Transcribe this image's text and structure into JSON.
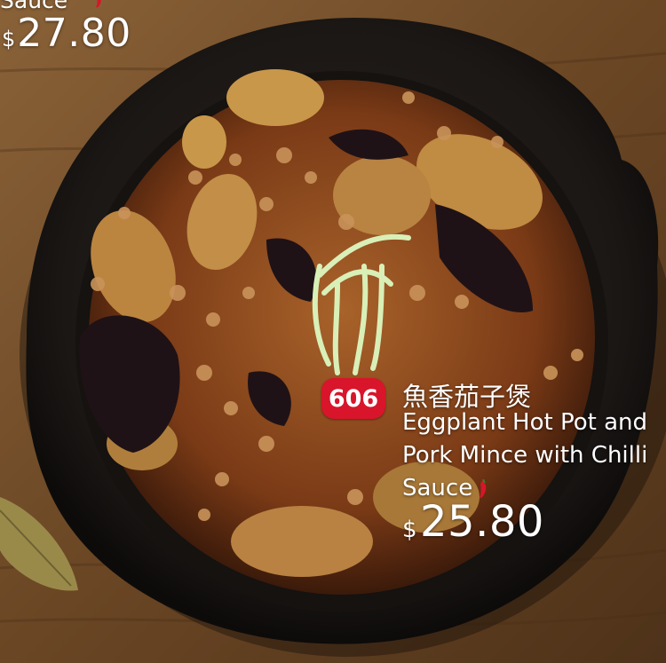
{
  "previous_item": {
    "sauce_fragment": "Sauce",
    "currency": "$",
    "price": "27.80",
    "chili_icon": "chili-pepper-icon"
  },
  "item": {
    "number": "606",
    "name_zh": "魚香茄子煲",
    "name_en_lines": [
      "Eggplant Hot Pot and",
      "Pork Mince with Chilli",
      "Sauce"
    ],
    "currency": "$",
    "price": "25.80",
    "spicy_icon": "chili-pepper-icon"
  },
  "colors": {
    "badge": "#d8152a",
    "text": "#ffffff",
    "chili": "#d8152a"
  }
}
